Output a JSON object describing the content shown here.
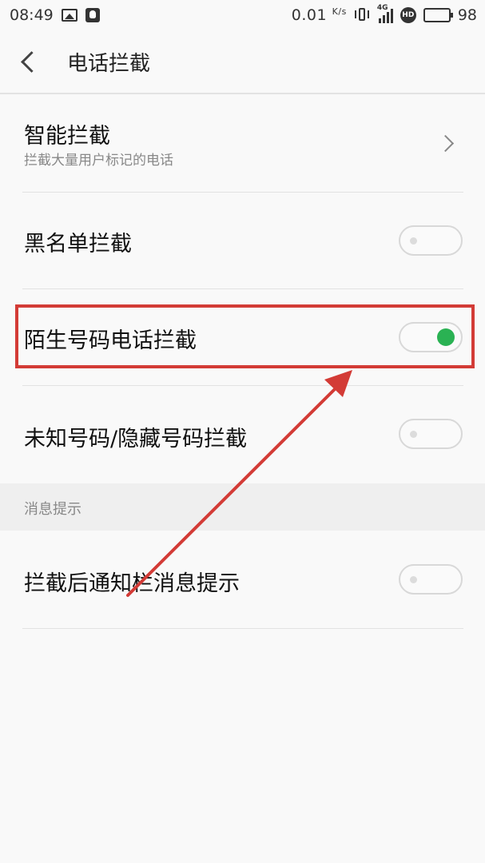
{
  "status_bar": {
    "time": "08:49",
    "speed_value": "0.01",
    "speed_unit": "K/s",
    "network_label": "4G",
    "hd_label": "HD",
    "battery_percent": "98",
    "icons": [
      "image-icon",
      "qq-icon",
      "vibrate-icon",
      "signal-icon",
      "hd-icon",
      "battery-icon"
    ]
  },
  "header": {
    "title": "电话拦截"
  },
  "items": [
    {
      "label": "智能拦截",
      "sublabel": "拦截大量用户标记的电话",
      "type": "link"
    },
    {
      "label": "黑名单拦截",
      "type": "toggle",
      "on": false
    },
    {
      "label": "陌生号码电话拦截",
      "type": "toggle",
      "on": true
    },
    {
      "label": "未知号码/隐藏号码拦截",
      "type": "toggle",
      "on": false
    }
  ],
  "section": {
    "title": "消息提示",
    "items": [
      {
        "label": "拦截后通知栏消息提示",
        "type": "toggle",
        "on": false
      }
    ]
  },
  "annotation": {
    "color": "#d33b36"
  },
  "colors": {
    "toggle_on": "#2ab253",
    "background": "#f9f9f9",
    "section_bg": "#efefef"
  }
}
